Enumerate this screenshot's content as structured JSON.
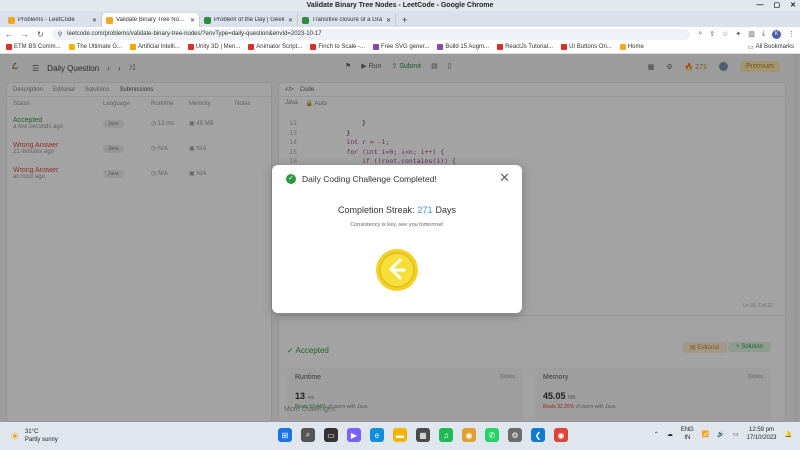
{
  "window": {
    "title": "Validate Binary Tree Nodes - LeetCode - Google Chrome",
    "controls": [
      "—",
      "▢",
      "✕"
    ]
  },
  "tabs": [
    {
      "label": "Problems - LeetCode",
      "color": "#f5a623"
    },
    {
      "label": "Validate Binary Tree Nodes",
      "color": "#f5a623"
    },
    {
      "label": "Problem of the Day | Geek",
      "color": "#2e8a3e"
    },
    {
      "label": "Transitive closure of a Gra",
      "color": "#2e8a3e"
    }
  ],
  "address": {
    "url": "leetcode.com/problems/validate-binary-tree-nodes/?envType=daily-question&envId=2023-10-17"
  },
  "bookmarks": [
    {
      "label": "ETM BS Comm...",
      "color": "#d93025"
    },
    {
      "label": "The Ultimate G...",
      "color": "#f4b400"
    },
    {
      "label": "Artificial Intelli...",
      "color": "#f4a300"
    },
    {
      "label": "Unity 3D | Men...",
      "color": "#d93025"
    },
    {
      "label": "Animator Script...",
      "color": "#d93025"
    },
    {
      "label": "Finch to Scale -...",
      "color": "#d93025"
    },
    {
      "label": "Free SVG gener...",
      "color": "#8e44ad"
    },
    {
      "label": "Build 15 Augm...",
      "color": "#8e44ad"
    },
    {
      "label": "ReactJs Tutorial...",
      "color": "#d93025"
    },
    {
      "label": "UI Buttons On...",
      "color": "#d93025"
    },
    {
      "label": "Home",
      "color": "#f5a623"
    }
  ],
  "bookmarks_all": "All Bookmarks",
  "lc": {
    "daily_label": "Daily Question",
    "run": "Run",
    "submit": "Submit",
    "streak": "271",
    "premium": "Premium",
    "left_tabs": [
      "Description",
      "Editorial",
      "Solutions",
      "Submissions"
    ],
    "sub_headers": [
      "Status",
      "Language",
      "Runtime",
      "Memory",
      "Notes"
    ],
    "submissions": [
      {
        "status": "Accepted",
        "time": "a few seconds ago",
        "lang": "Java",
        "runtime": "13 ms",
        "memory": "45 MB",
        "kind": "acc"
      },
      {
        "status": "Wrong Answer",
        "time": "21 minutes ago",
        "lang": "Java",
        "runtime": "N/A",
        "memory": "N/A",
        "kind": "wrong"
      },
      {
        "status": "Wrong Answer",
        "time": "an hour ago",
        "lang": "Java",
        "runtime": "N/A",
        "memory": "N/A",
        "kind": "wrong"
      }
    ],
    "code_tab": "Code",
    "code_lang": "Java",
    "code_mode": "Auto",
    "code_lines": [
      {
        "n": "12",
        "t": "            }"
      },
      {
        "n": "13",
        "t": "        }"
      },
      {
        "n": "14",
        "t": "        int r = -1;"
      },
      {
        "n": "15",
        "t": "        for (int i=0; i<n; i++) {"
      },
      {
        "n": "16",
        "t": "            if (!root.contains(i)) {"
      }
    ],
    "cursor_pos": "Ln 26, Col 22",
    "result_status": "Accepted",
    "editorial_btn": "Editorial",
    "solution_btn": "Solution",
    "runtime_card": {
      "title": "Runtime",
      "details": "Details",
      "value": "13",
      "unit": "ms",
      "beats_label": "Beats",
      "beats_pct": "52.44%",
      "beats_tail": "of users with Java"
    },
    "memory_card": {
      "title": "Memory",
      "details": "Details",
      "value": "45.05",
      "unit": "MB",
      "beats_label": "Beats",
      "beats_pct": "32.25%",
      "beats_tail": "of users with Java"
    },
    "more_challenges": "More challenges"
  },
  "modal": {
    "title": "Daily Coding Challenge Completed!",
    "streak_label": "Completion Streak:",
    "streak_value": "271",
    "streak_unit": "Days",
    "subtitle": "Consistency is key, see you tomorrow!"
  },
  "taskbar": {
    "temp": "31°C",
    "weather": "Partly sunny",
    "lang1": "ENG",
    "lang2": "IN",
    "time": "12:59 pm",
    "date": "17/10/2023",
    "apps": [
      {
        "name": "windows-start-icon",
        "color": "#1a73e8",
        "glyph": "⊞"
      },
      {
        "name": "search-icon",
        "color": "#555555",
        "glyph": "⌕"
      },
      {
        "name": "task-view-icon",
        "color": "#333333",
        "glyph": "▭"
      },
      {
        "name": "meet-icon",
        "color": "#7b61ff",
        "glyph": "▶"
      },
      {
        "name": "edge-icon",
        "color": "#0f8fdc",
        "glyph": "e"
      },
      {
        "name": "file-explorer-icon",
        "color": "#f4b400",
        "glyph": "▬"
      },
      {
        "name": "store-icon",
        "color": "#4a4a4a",
        "glyph": "▦"
      },
      {
        "name": "spotify-icon",
        "color": "#1db954",
        "glyph": "♫"
      },
      {
        "name": "chrome-icon-1",
        "color": "#e0a030",
        "glyph": "◉"
      },
      {
        "name": "whatsapp-icon",
        "color": "#25d366",
        "glyph": "✆"
      },
      {
        "name": "settings-icon",
        "color": "#6b6b6b",
        "glyph": "⚙"
      },
      {
        "name": "vscode-icon",
        "color": "#0e7ad1",
        "glyph": "❮"
      },
      {
        "name": "chrome-icon-2",
        "color": "#db4437",
        "glyph": "◉"
      }
    ]
  }
}
